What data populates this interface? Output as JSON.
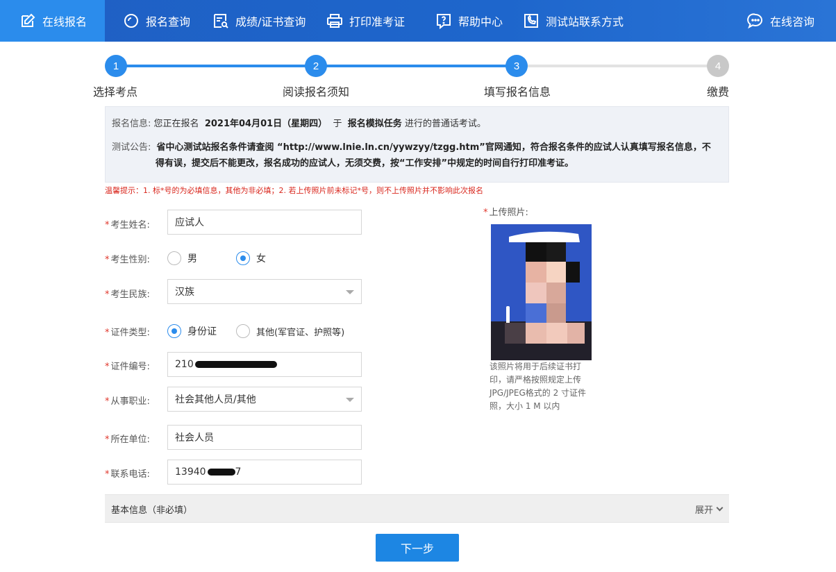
{
  "nav": {
    "items": [
      {
        "label": "在线报名",
        "icon": "edit-icon"
      },
      {
        "label": "报名查询",
        "icon": "search-icon"
      },
      {
        "label": "成绩/证书查询",
        "icon": "certificate-search-icon"
      },
      {
        "label": "打印准考证",
        "icon": "printer-icon"
      },
      {
        "label": "帮助中心",
        "icon": "help-icon"
      },
      {
        "label": "测试站联系方式",
        "icon": "phone-icon"
      }
    ],
    "consult": {
      "label": "在线咨询",
      "icon": "chat-icon"
    }
  },
  "steps": [
    {
      "num": "1",
      "label": "选择考点",
      "state": "done"
    },
    {
      "num": "2",
      "label": "阅读报名须知",
      "state": "done"
    },
    {
      "num": "3",
      "label": "填写报名信息",
      "state": "current"
    },
    {
      "num": "4",
      "label": "缴费",
      "state": "todo"
    }
  ],
  "info": {
    "key1": "报名信息:",
    "text1a": "您正在报名",
    "date": "2021年04月01日（星期四）",
    "text1b": "于",
    "task": "报名模拟任务",
    "text1c": "进行的普通话考试。",
    "key2": "测试公告:",
    "notice_line1": "省中心测试站报名条件请查阅 “http://www.lnie.ln.cn/yywzyy/tzgg.htm”官网通知，符合报名条件的应试人认真填写报名信息，不",
    "notice_line2": "得有误，提交后不能更改，报名成功的应试人，无须交费，按“工作安排”中规定的时间自行打印准考证。"
  },
  "tip": "温馨提示：1. 标*号的为必填信息，其他为非必填；2. 若上传照片前未标记*号，则不上传照片并不影响此次报名",
  "form": {
    "name": {
      "label": "考生姓名:",
      "value": "应试人"
    },
    "gender": {
      "label": "考生性别:",
      "options": [
        "男",
        "女"
      ],
      "selected": "女"
    },
    "ethnicity": {
      "label": "考生民族:",
      "value": "汉族"
    },
    "id_type": {
      "label": "证件类型:",
      "options": [
        "身份证",
        "其他(军官证、护照等)"
      ],
      "selected": "身份证"
    },
    "id_number": {
      "label": "证件编号:",
      "value_visible": "210"
    },
    "occupation": {
      "label": "从事职业:",
      "value": "社会其他人员/其他"
    },
    "employer": {
      "label": "所在单位:",
      "value": "社会人员"
    },
    "phone": {
      "label": "联系电话:",
      "value_visible": "13940",
      "value_tail": "7"
    }
  },
  "photo": {
    "label": "上传照片:",
    "note": "该照片将用于后续证书打印，请严格按照规定上传JPG/JPEG格式的 2 寸证件照，大小 1 M 以内"
  },
  "basic": {
    "title": "基本信息（非必填）",
    "expand": "展开"
  },
  "next_button": "下一步",
  "colors": {
    "nav": "#1e66cc",
    "active": "#2b8cec",
    "primary_button": "#1d86e3",
    "required": "#e0362b"
  }
}
